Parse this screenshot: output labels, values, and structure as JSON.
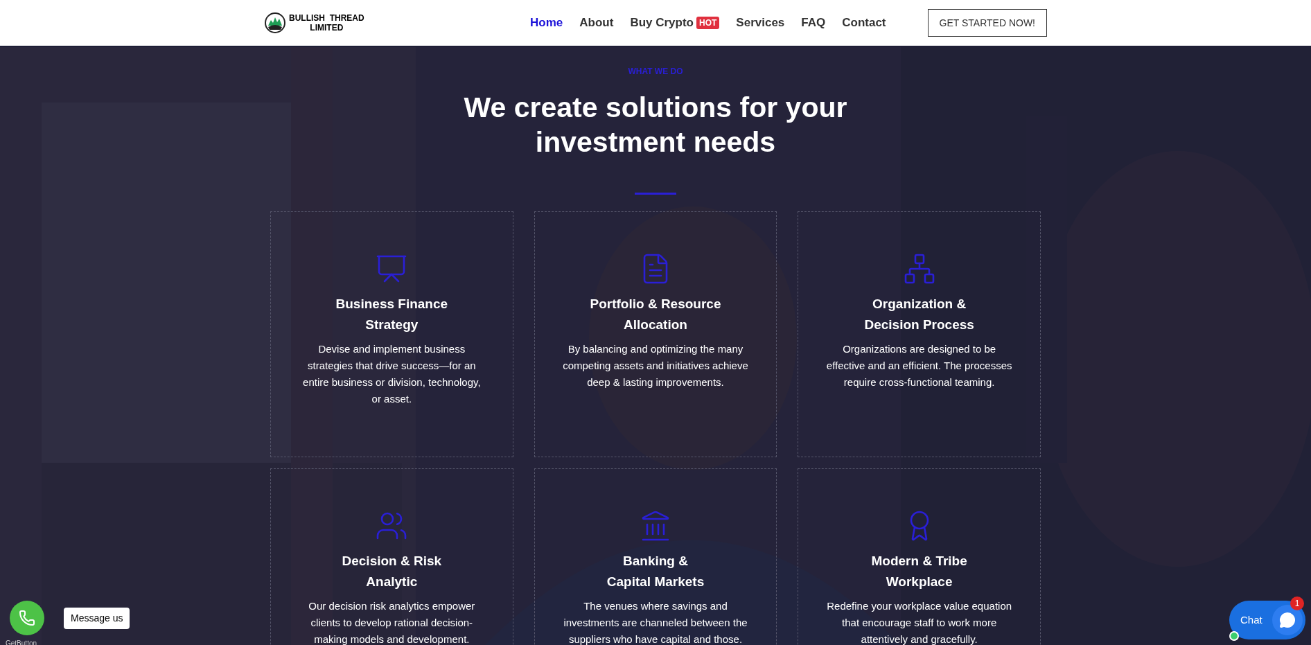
{
  "header": {
    "logo": {
      "line1": "BULLISH  THREAD",
      "line2": "LIMITED"
    },
    "nav": [
      {
        "label": "Home",
        "selected": true
      },
      {
        "label": "About",
        "selected": false
      },
      {
        "label": "Buy Crypto",
        "selected": false,
        "badge": "HOT"
      },
      {
        "label": "Services",
        "selected": false
      },
      {
        "label": "FAQ",
        "selected": false
      },
      {
        "label": "Contact",
        "selected": false
      }
    ],
    "cta": "GET STARTED NOW!"
  },
  "section": {
    "eyebrow": "WHAT WE DO",
    "title_line1": "We create solutions for your",
    "title_line2": "investment needs",
    "cards": [
      {
        "kind": "presentation",
        "title_line1": "Business Finance",
        "title_line2": "Strategy",
        "text": "Devise and implement business strategies that drive success—for an entire business or division, technology, or asset."
      },
      {
        "kind": "document",
        "title_line1": "Portfolio & Resource",
        "title_line2": "Allocation",
        "text": "By balancing and optimizing the many competing assets and initiatives achieve deep & lasting improvements."
      },
      {
        "kind": "network",
        "title_line1": "Organization &",
        "title_line2": "Decision Process",
        "text": "Organizations are designed to be effective and an efficient. The processes require cross-functional teaming."
      },
      {
        "kind": "meeting",
        "title_line1": "Decision & Risk",
        "title_line2": "Analytic",
        "text": "Our decision risk analytics empower clients to develop rational decision-making models and development."
      },
      {
        "kind": "bank",
        "title_line1": "Banking &",
        "title_line2": "Capital Markets",
        "text": "The venues where savings and investments are channeled between the suppliers who have capital and those."
      },
      {
        "kind": "certificate",
        "title_line1": "Modern & Tribe",
        "title_line2": "Workplace",
        "text": "Redefine your workplace value equation that encourage staff to work more attentively and gracefully."
      }
    ]
  },
  "whatsapp": {
    "tooltip": "Message us",
    "credit": "GetButton"
  },
  "chat": {
    "label": "Chat",
    "count": "1"
  }
}
